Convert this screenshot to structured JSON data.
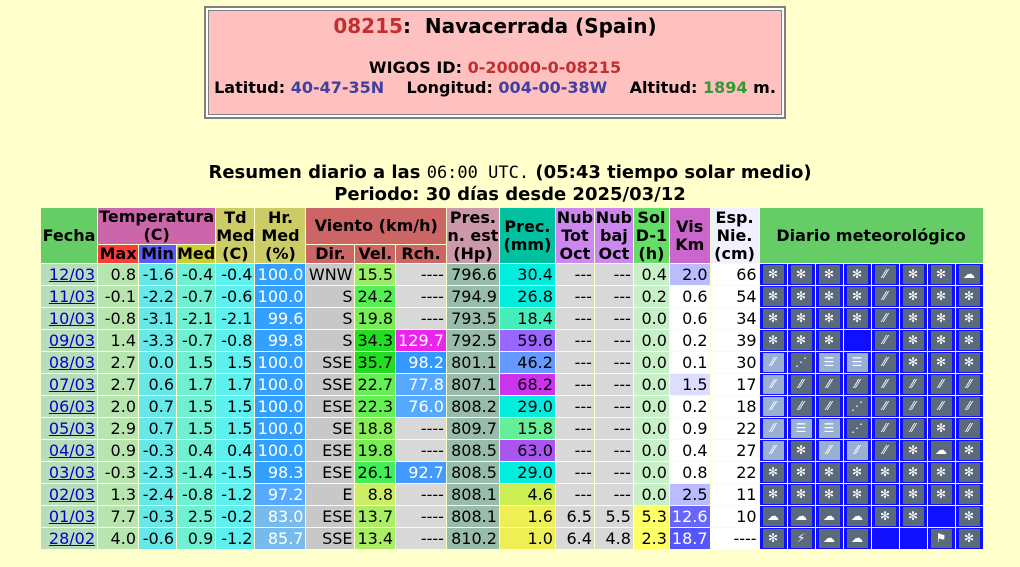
{
  "station": {
    "code": "08215",
    "name": "Navacerrada (Spain)",
    "wigos_label": "WIGOS ID:",
    "wigos_id": "0-20000-0-08215",
    "lat_label": "Latitud:",
    "lat": "40-47-35N",
    "lon_label": "Longitud:",
    "lon": "004-00-38W",
    "alt_label": "Altitud:",
    "alt": "1894",
    "alt_unit": "m."
  },
  "summary": {
    "prefix": "Resumen diario a las",
    "time": "06:00 UTC.",
    "solar": "(05:43 tiempo solar medio)",
    "periodo_label": "Periodo:",
    "periodo": "30 días desde 2025/03/12"
  },
  "headers": {
    "fecha": "Fecha",
    "temperatura": "Temperatura (C)",
    "max": "Max",
    "min": "Min",
    "med": "Med",
    "td": "Td Med (C)",
    "hr": "Hr. Med (%)",
    "viento": "Viento (km/h)",
    "dir": "Dir.",
    "vel": "Vel.",
    "rch": "Rch.",
    "pres": "Pres. n. est (Hp)",
    "prec": "Prec. (mm)",
    "nubtot": "Nub Tot Oct",
    "nubbaj": "Nub baj Oct",
    "sol": "Sol D-1 (h)",
    "vis": "Vis Km",
    "esp": "Esp. Nie. (cm)",
    "diario": "Diario meteorológico"
  },
  "rows": [
    {
      "fecha": "12/03",
      "max": "0.8",
      "min": "-1.6",
      "med": "-0.4",
      "td": "-0.4",
      "hr": "100.0",
      "hr_color": "#33a0ff",
      "dir": "WNW",
      "vel": "15.5",
      "vel_color": "#99ee66",
      "rch": "----",
      "rch_color": "",
      "pres": "796.6",
      "prec": "30.4",
      "prec_color": "#00eedd",
      "nubtot": "---",
      "nubbaj": "---",
      "sol": "0.4",
      "vis": "2.0",
      "vis_color": "#bbbbff",
      "esp": "66",
      "icons": [
        "snow",
        "snow",
        "snow",
        "snow",
        "rain",
        "snow",
        "snow",
        "fog"
      ]
    },
    {
      "fecha": "11/03",
      "max": "-0.1",
      "min": "-2.2",
      "med": "-0.7",
      "td": "-0.6",
      "hr": "100.0",
      "hr_color": "#33a0ff",
      "dir": "S",
      "vel": "24.2",
      "vel_color": "#55ee55",
      "rch": "----",
      "rch_color": "",
      "pres": "794.9",
      "prec": "26.8",
      "prec_color": "#00eedd",
      "nubtot": "---",
      "nubbaj": "---",
      "sol": "0.2",
      "vis": "0.6",
      "vis_color": "#ffffff",
      "esp": "54",
      "icons": [
        "snow",
        "snow",
        "snow",
        "snow",
        "rain",
        "snow",
        "snow",
        "snow"
      ]
    },
    {
      "fecha": "10/03",
      "max": "-0.8",
      "min": "-3.1",
      "med": "-2.1",
      "td": "-2.1",
      "hr": "99.6",
      "hr_color": "#33a0ff",
      "dir": "S",
      "vel": "19.8",
      "vel_color": "#77ee55",
      "rch": "----",
      "rch_color": "",
      "pres": "793.5",
      "prec": "18.4",
      "prec_color": "#44eebb",
      "nubtot": "---",
      "nubbaj": "---",
      "sol": "0.0",
      "vis": "0.6",
      "vis_color": "#ffffff",
      "esp": "34",
      "icons": [
        "snow",
        "snow",
        "snow",
        "snow",
        "rain",
        "snow",
        "snow",
        "snow"
      ]
    },
    {
      "fecha": "09/03",
      "max": "1.4",
      "min": "-3.3",
      "med": "-0.7",
      "td": "-0.8",
      "hr": "99.8",
      "hr_color": "#33a0ff",
      "dir": "S",
      "vel": "34.3",
      "vel_color": "#22dd22",
      "rch": "129.7",
      "rch_color": "#ee22ee",
      "pres": "792.5",
      "prec": "59.6",
      "prec_color": "#9966ff",
      "nubtot": "---",
      "nubbaj": "---",
      "sol": "0.0",
      "vis": "0.2",
      "vis_color": "#ffffff",
      "esp": "39",
      "icons": [
        "snow",
        "snow",
        "snow",
        "blank",
        "rain",
        "snow",
        "snow",
        "snow"
      ]
    },
    {
      "fecha": "08/03",
      "max": "2.7",
      "min": "0.0",
      "med": "1.5",
      "td": "1.5",
      "hr": "100.0",
      "hr_color": "#33a0ff",
      "dir": "SSE",
      "vel": "35.7",
      "vel_color": "#22dd22",
      "rch": "98.2",
      "rch_color": "#3399ff",
      "pres": "801.1",
      "prec": "46.2",
      "prec_color": "#6699ff",
      "nubtot": "---",
      "nubbaj": "---",
      "sol": "0.0",
      "vis": "0.1",
      "vis_color": "#ffffff",
      "esp": "30",
      "icons": [
        "rainl",
        "drops",
        "fogl",
        "fogl",
        "rain",
        "snow",
        "snow",
        "snow"
      ]
    },
    {
      "fecha": "07/03",
      "max": "2.7",
      "min": "0.6",
      "med": "1.7",
      "td": "1.7",
      "hr": "100.0",
      "hr_color": "#33a0ff",
      "dir": "SSE",
      "vel": "22.7",
      "vel_color": "#66ee55",
      "rch": "77.8",
      "rch_color": "#55aaff",
      "pres": "807.1",
      "prec": "68.2",
      "prec_color": "#cc33ee",
      "nubtot": "---",
      "nubbaj": "---",
      "sol": "0.0",
      "vis": "1.5",
      "vis_color": "#ddddff",
      "esp": "17",
      "icons": [
        "rainl",
        "rain",
        "rain",
        "rain",
        "rain",
        "rain",
        "rain",
        "rain"
      ]
    },
    {
      "fecha": "06/03",
      "max": "2.0",
      "min": "0.7",
      "med": "1.5",
      "td": "1.5",
      "hr": "100.0",
      "hr_color": "#33a0ff",
      "dir": "ESE",
      "vel": "22.3",
      "vel_color": "#66ee55",
      "rch": "76.0",
      "rch_color": "#55aaff",
      "pres": "808.2",
      "prec": "29.0",
      "prec_color": "#00eedd",
      "nubtot": "---",
      "nubbaj": "---",
      "sol": "0.0",
      "vis": "0.2",
      "vis_color": "#ffffff",
      "esp": "18",
      "icons": [
        "rainl",
        "rain",
        "rain",
        "drops",
        "rain",
        "rain",
        "rain",
        "rain"
      ]
    },
    {
      "fecha": "05/03",
      "max": "2.9",
      "min": "0.7",
      "med": "1.5",
      "td": "1.5",
      "hr": "100.0",
      "hr_color": "#33a0ff",
      "dir": "SE",
      "vel": "18.8",
      "vel_color": "#88ee55",
      "rch": "----",
      "rch_color": "",
      "pres": "809.7",
      "prec": "15.8",
      "prec_color": "#66ee99",
      "nubtot": "---",
      "nubbaj": "---",
      "sol": "0.0",
      "vis": "0.9",
      "vis_color": "#ffffff",
      "esp": "22",
      "icons": [
        "rainl",
        "fogl",
        "fogl",
        "drops",
        "rain",
        "rain",
        "snow",
        "rain"
      ]
    },
    {
      "fecha": "04/03",
      "max": "0.9",
      "min": "-0.3",
      "med": "0.4",
      "td": "0.4",
      "hr": "100.0",
      "hr_color": "#33a0ff",
      "dir": "ESE",
      "vel": "19.8",
      "vel_color": "#77ee55",
      "rch": "----",
      "rch_color": "",
      "pres": "808.5",
      "prec": "63.0",
      "prec_color": "#aa55ee",
      "nubtot": "---",
      "nubbaj": "---",
      "sol": "0.0",
      "vis": "0.4",
      "vis_color": "#ffffff",
      "esp": "27",
      "icons": [
        "rainl",
        "snow",
        "rainl",
        "rainl",
        "rain",
        "snow",
        "fog",
        "snow"
      ]
    },
    {
      "fecha": "03/03",
      "max": "-0.3",
      "min": "-2.3",
      "med": "-1.4",
      "td": "-1.5",
      "hr": "98.3",
      "hr_color": "#33a0ff",
      "dir": "ESE",
      "vel": "26.1",
      "vel_color": "#44ee55",
      "rch": "92.7",
      "rch_color": "#4499ff",
      "pres": "808.5",
      "prec": "29.0",
      "prec_color": "#00eedd",
      "nubtot": "---",
      "nubbaj": "---",
      "sol": "0.0",
      "vis": "0.8",
      "vis_color": "#ffffff",
      "esp": "22",
      "icons": [
        "snow",
        "snow",
        "snow",
        "snow",
        "snow",
        "snow",
        "snow",
        "snow"
      ]
    },
    {
      "fecha": "02/03",
      "max": "1.3",
      "min": "-2.4",
      "med": "-0.8",
      "td": "-1.2",
      "hr": "97.2",
      "hr_color": "#55aaff",
      "dir": "E",
      "vel": "8.8",
      "vel_color": "#ccee66",
      "rch": "----",
      "rch_color": "",
      "pres": "808.1",
      "prec": "4.6",
      "prec_color": "#ccee55",
      "nubtot": "---",
      "nubbaj": "---",
      "sol": "0.0",
      "vis": "2.5",
      "vis_color": "#bbbbff",
      "esp": "11",
      "icons": [
        "snow",
        "snow",
        "snow",
        "snow",
        "snow",
        "snow",
        "snow",
        "snow"
      ]
    },
    {
      "fecha": "01/03",
      "max": "7.7",
      "min": "-0.3",
      "med": "2.5",
      "td": "-0.2",
      "hr": "83.0",
      "hr_color": "#77bbee",
      "dir": "ESE",
      "vel": "13.7",
      "vel_color": "#aaee66",
      "rch": "----",
      "rch_color": "",
      "pres": "808.1",
      "prec": "1.6",
      "prec_color": "#eeee55",
      "nubtot": "6.5",
      "nubbaj": "5.5",
      "sol": "5.3",
      "vis": "12.6",
      "vis_color": "#6666ff",
      "esp": "10",
      "icons": [
        "fog",
        "fog",
        "fog",
        "fog",
        "snow",
        "snow",
        "blank",
        "snow"
      ]
    },
    {
      "fecha": "28/02",
      "max": "4.0",
      "min": "-0.6",
      "med": "0.9",
      "td": "-1.2",
      "hr": "85.7",
      "hr_color": "#77bbee",
      "dir": "SSE",
      "vel": "13.4",
      "vel_color": "#aaee66",
      "rch": "----",
      "rch_color": "",
      "pres": "810.2",
      "prec": "1.0",
      "prec_color": "#eeee55",
      "nubtot": "6.4",
      "nubbaj": "4.8",
      "sol": "2.3",
      "vis": "18.7",
      "vis_color": "#5555ff",
      "esp": "----",
      "icons": [
        "snow",
        "storm",
        "fog",
        "fog",
        "blank",
        "blank",
        "wind",
        "snow"
      ]
    }
  ],
  "icon_glyphs": {
    "snow": "✻",
    "rain": "⁄⁄",
    "rainl": "⁄⁄",
    "fog": "☁",
    "fogl": "☰",
    "drops": "⋰",
    "storm": "⚡",
    "wind": "⚑",
    "blank": ""
  }
}
